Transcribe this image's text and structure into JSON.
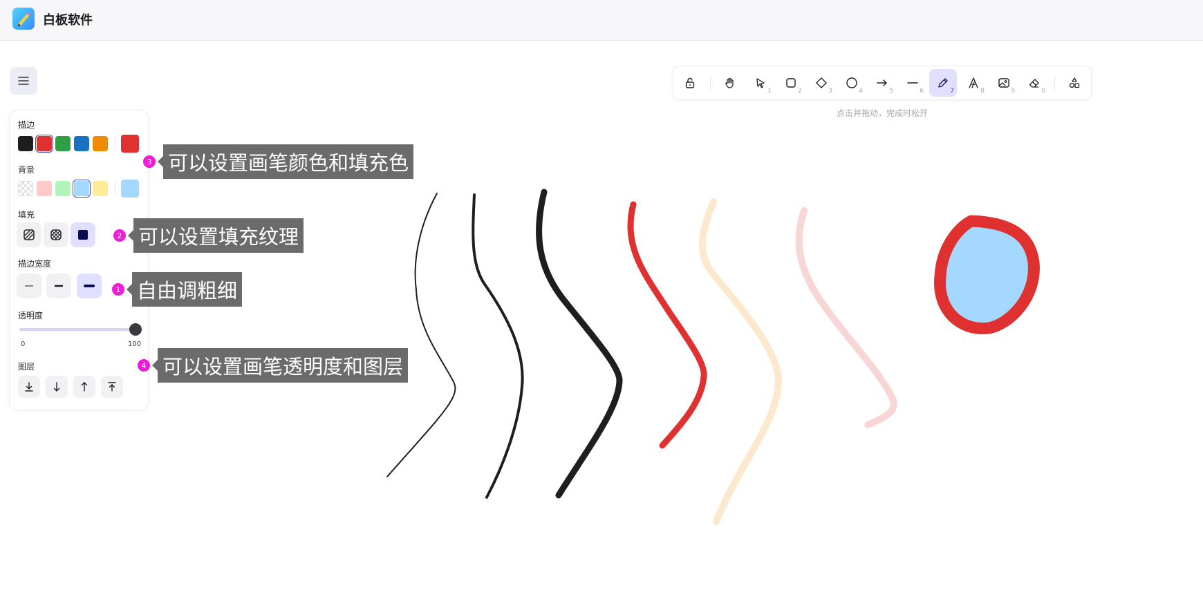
{
  "app": {
    "title": "白板软件",
    "logo_icon": "pencil-logo-icon"
  },
  "panel": {
    "stroke_label": "描边",
    "stroke_colors": [
      "#1e1e1e",
      "#e03131",
      "#2f9e44",
      "#1971c2",
      "#f08c00"
    ],
    "stroke_selected": "#e03131",
    "background_label": "背景",
    "background_colors": [
      "transparent",
      "#ffc9c9",
      "#b2f2bb",
      "#a5d8ff",
      "#ffec99"
    ],
    "background_selected": "#a5d8ff",
    "fill_label": "填充",
    "fill_options": [
      "hatch-fill-icon",
      "cross-hatch-fill-icon",
      "solid-fill-icon"
    ],
    "width_label": "描边宽度",
    "width_options": [
      "thin-line-icon",
      "medium-line-icon",
      "thick-line-icon"
    ],
    "opacity_label": "透明度",
    "opacity_min": "0",
    "opacity_max": "100",
    "opacity_value": 100,
    "layer_label": "图层",
    "layer_buttons": [
      "send-to-back-icon",
      "send-backward-icon",
      "bring-forward-icon",
      "bring-to-front-icon"
    ]
  },
  "toolbar": {
    "tools": [
      {
        "icon": "lock-icon",
        "key": ""
      },
      {
        "icon": "hand-icon",
        "key": ""
      },
      {
        "icon": "selection-icon",
        "key": "1"
      },
      {
        "icon": "rectangle-icon",
        "key": "2"
      },
      {
        "icon": "diamond-icon",
        "key": "3"
      },
      {
        "icon": "ellipse-icon",
        "key": "4"
      },
      {
        "icon": "arrow-icon",
        "key": "5"
      },
      {
        "icon": "line-icon",
        "key": "6"
      },
      {
        "icon": "pencil-icon",
        "key": "7"
      },
      {
        "icon": "text-icon",
        "key": "8"
      },
      {
        "icon": "image-icon",
        "key": "9"
      },
      {
        "icon": "eraser-icon",
        "key": "0"
      },
      {
        "icon": "shapes-library-icon",
        "key": ""
      }
    ],
    "active_tool": "pencil-icon",
    "hint": "点击并拖动，完成时松开"
  },
  "annotations": [
    {
      "num": "3",
      "text": "可以设置画笔颜色和填充色"
    },
    {
      "num": "2",
      "text": "可以设置填充纹理"
    },
    {
      "num": "1",
      "text": "自由调粗细"
    },
    {
      "num": "4",
      "text": "可以设置画笔透明度和图层"
    }
  ],
  "canvas_strokes": [
    {
      "color": "#1e1e1e",
      "width": "thin",
      "opacity": 100
    },
    {
      "color": "#1e1e1e",
      "width": "medium",
      "opacity": 100
    },
    {
      "color": "#1e1e1e",
      "width": "thick",
      "opacity": 100
    },
    {
      "color": "#e03131",
      "width": "thick",
      "opacity": 100
    },
    {
      "color": "#f08c00",
      "width": "thick",
      "opacity": 20
    },
    {
      "color": "#e03131",
      "width": "thick",
      "opacity": 20
    },
    {
      "color": "#e03131",
      "width": "thick",
      "opacity": 100,
      "fill": "#a5d8ff"
    }
  ]
}
